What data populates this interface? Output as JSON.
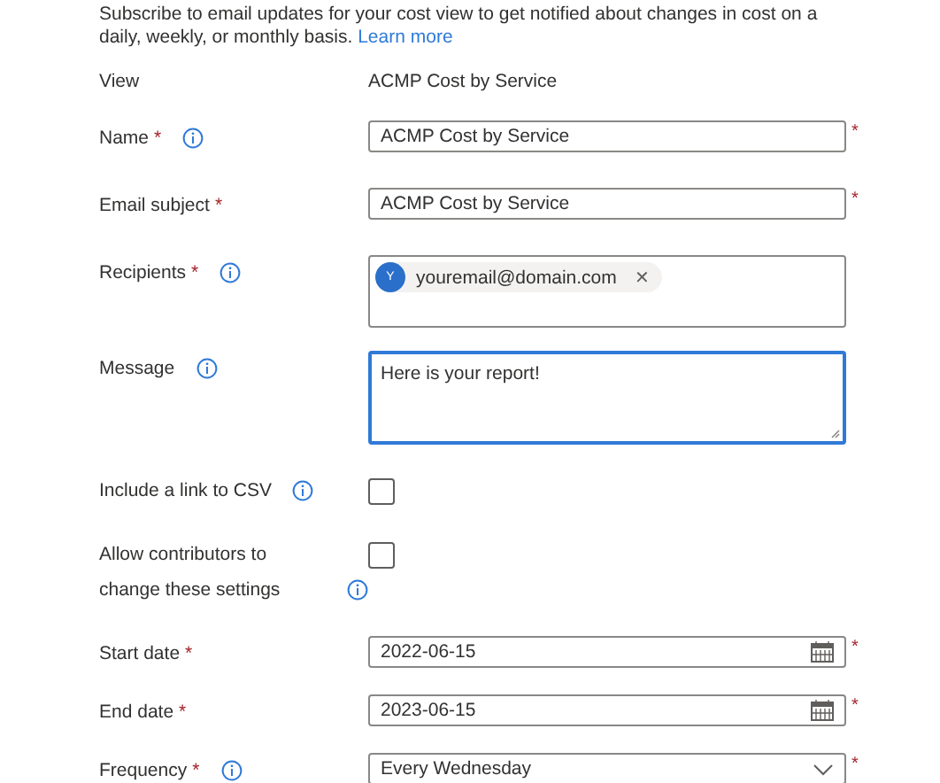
{
  "intro": {
    "text": "Subscribe to email updates for your cost view to get notified about changes in cost on a daily, weekly, or monthly basis.",
    "link": "Learn more"
  },
  "rows": [
    {
      "kind": "static",
      "label": "View",
      "value": "ACMP Cost by Service"
    },
    {
      "kind": "text",
      "label": "Name",
      "label_mark": "*",
      "info": true,
      "value": "ACMP Cost by Service",
      "field_mark": "*"
    },
    {
      "kind": "text",
      "label": "Email subject",
      "label_mark": "*",
      "info": false,
      "value": "ACMP Cost by Service",
      "field_mark": "*"
    },
    {
      "kind": "recipients",
      "label": "Recipients",
      "label_mark": "*",
      "info": true,
      "recipients": [
        {
          "initial": "Y",
          "email": "youremail@domain.com",
          "remove": "✕"
        }
      ]
    },
    {
      "kind": "textarea",
      "label": "Message",
      "info": true,
      "value": "Here is your report!",
      "focused": true
    },
    {
      "kind": "checkbox",
      "label": "Include a link to CSV",
      "info": true,
      "checked": false
    },
    {
      "kind": "checkbox",
      "label": "Allow contributors to change these settings",
      "info": true,
      "checked": false
    },
    {
      "kind": "date",
      "label": "Start date",
      "label_mark": "*",
      "info": false,
      "value": "2022-06-15",
      "field_mark": "*"
    },
    {
      "kind": "date",
      "label": "End date",
      "label_mark": "*",
      "info": false,
      "value": "2023-06-15",
      "field_mark": "*"
    },
    {
      "kind": "dropdown",
      "label": "Frequency",
      "label_mark": "*",
      "info": true,
      "value": "Every Wednesday",
      "field_mark": "*"
    }
  ]
}
